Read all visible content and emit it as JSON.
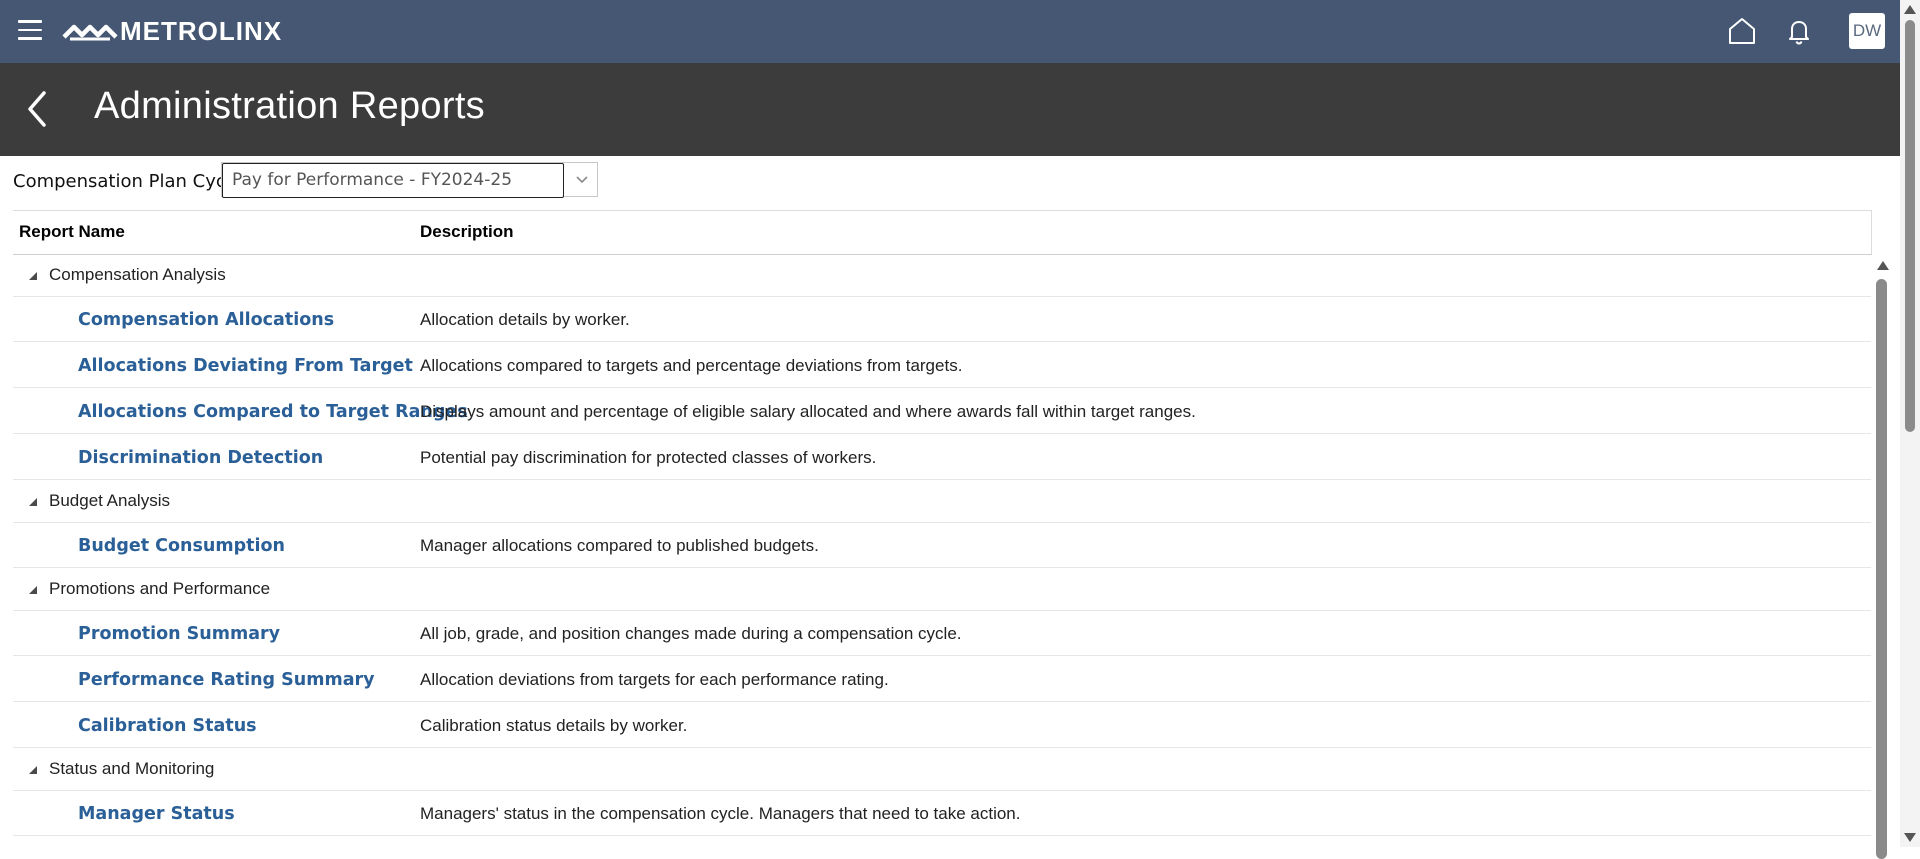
{
  "app": {
    "brand": "METROLINX",
    "user_initials": "DW"
  },
  "header": {
    "title": "Administration Reports"
  },
  "filter": {
    "label": "Compensation Plan Cycle",
    "value": "Pay for Performance - FY2024-25"
  },
  "table": {
    "columns": [
      "Report Name",
      "Description"
    ],
    "groups": [
      {
        "name": "Compensation Analysis",
        "items": [
          {
            "name": "Compensation Allocations",
            "description": "Allocation details by worker."
          },
          {
            "name": "Allocations Deviating From Target",
            "description": "Allocations compared to targets and percentage deviations from targets."
          },
          {
            "name": "Allocations Compared to Target Ranges",
            "description": "Displays amount and percentage of eligible salary allocated and where awards fall within target ranges."
          },
          {
            "name": "Discrimination Detection",
            "description": "Potential pay discrimination for protected classes of workers."
          }
        ]
      },
      {
        "name": "Budget Analysis",
        "items": [
          {
            "name": "Budget Consumption",
            "description": "Manager allocations compared to published budgets."
          }
        ]
      },
      {
        "name": "Promotions and Performance",
        "items": [
          {
            "name": "Promotion Summary",
            "description": "All job, grade, and position changes made during a compensation cycle."
          },
          {
            "name": "Performance Rating Summary",
            "description": "Allocation deviations from targets for each performance rating."
          },
          {
            "name": "Calibration Status",
            "description": "Calibration status details by worker."
          }
        ]
      },
      {
        "name": "Status and Monitoring",
        "items": [
          {
            "name": "Manager Status",
            "description": "Managers' status in the compensation cycle. Managers that need to take action."
          }
        ]
      }
    ]
  },
  "colors": {
    "topbar": "#455773",
    "page_header": "#3c3c3c",
    "link": "#2a5f97"
  },
  "icons": [
    "hamburger-menu-icon",
    "metrolinx-logo-icon",
    "home-icon",
    "bell-icon",
    "back-chevron-icon",
    "chevron-down-icon"
  ]
}
